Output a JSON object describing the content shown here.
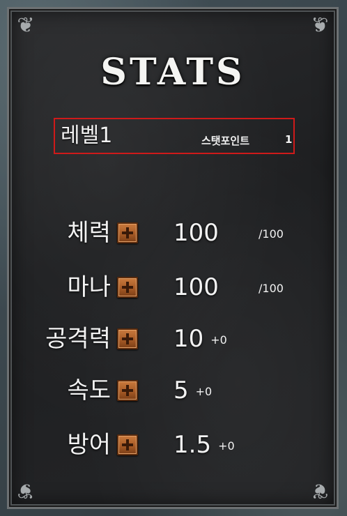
{
  "panel": {
    "title": "STATS",
    "level": {
      "label": "레벨1",
      "stat_points_label": "스탯포인트",
      "stat_points_value": "1"
    },
    "stats": [
      {
        "name": "체력",
        "value": "100",
        "max": "/100",
        "bonus": ""
      },
      {
        "name": "마나",
        "value": "100",
        "max": "/100",
        "bonus": ""
      },
      {
        "name": "공격력",
        "value": "10",
        "max": "",
        "bonus": "+0"
      },
      {
        "name": "속도",
        "value": "5",
        "max": "",
        "bonus": "+0"
      },
      {
        "name": "방어",
        "value": "1.5",
        "max": "",
        "bonus": "+0"
      }
    ],
    "colors": {
      "highlight_border": "#cf1a1a",
      "plus_button": "#a65a26",
      "text": "#f2f2f2"
    },
    "icons": [
      "plus-icon",
      "corner-ornament-icon"
    ]
  }
}
